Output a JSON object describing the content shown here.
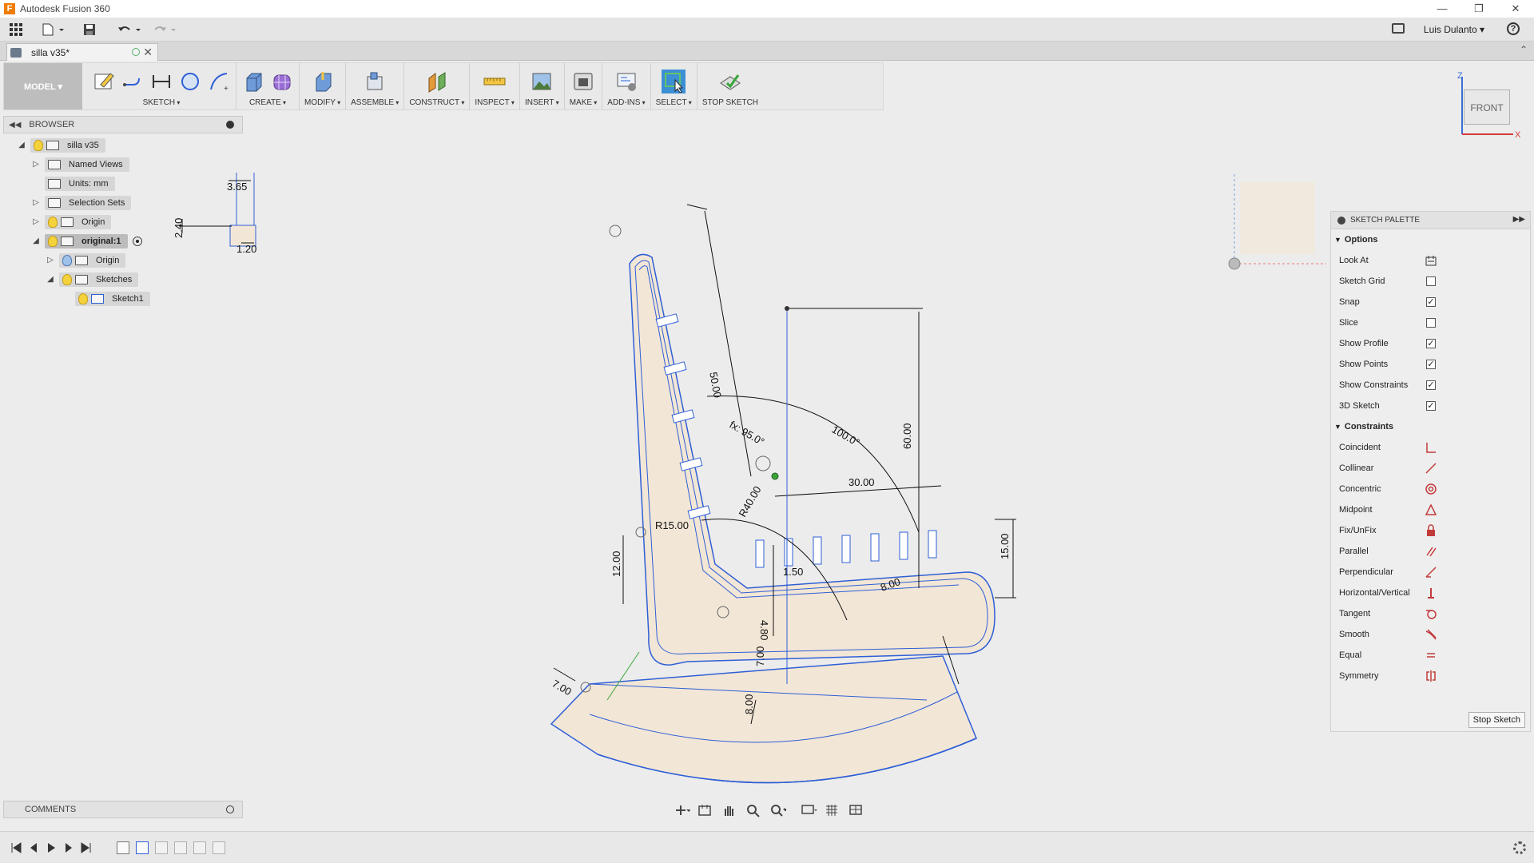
{
  "window": {
    "title": "Autodesk Fusion 360",
    "minimize": "—",
    "restore": "❐",
    "close": "✕"
  },
  "quick_access": {
    "user": "Luis Dulanto ▾",
    "help": "?"
  },
  "document_tab": {
    "label": "silla v35*",
    "close": "✕"
  },
  "toolbar": {
    "workspace": "MODEL ▾",
    "groups": [
      {
        "label": "SKETCH"
      },
      {
        "label": "CREATE"
      },
      {
        "label": "MODIFY"
      },
      {
        "label": "ASSEMBLE"
      },
      {
        "label": "CONSTRUCT"
      },
      {
        "label": "INSPECT"
      },
      {
        "label": "INSERT"
      },
      {
        "label": "MAKE"
      },
      {
        "label": "ADD-INS"
      },
      {
        "label": "SELECT"
      },
      {
        "label": "STOP SKETCH"
      }
    ]
  },
  "browser": {
    "title": "BROWSER",
    "items": [
      {
        "label": "silla v35"
      },
      {
        "label": "Named Views"
      },
      {
        "label": "Units: mm"
      },
      {
        "label": "Selection Sets"
      },
      {
        "label": "Origin"
      },
      {
        "label": "original:1"
      },
      {
        "label": "Origin"
      },
      {
        "label": "Sketches"
      },
      {
        "label": "Sketch1"
      }
    ]
  },
  "viewcube": {
    "face": "FRONT",
    "z": "Z",
    "x": "X"
  },
  "palette": {
    "title": "SKETCH PALETTE",
    "options_title": "Options",
    "options": [
      {
        "label": "Look At",
        "type": "icon",
        "icon": "look-at-icon"
      },
      {
        "label": "Sketch Grid",
        "checked": false
      },
      {
        "label": "Snap",
        "checked": true
      },
      {
        "label": "Slice",
        "checked": false
      },
      {
        "label": "Show Profile",
        "checked": true
      },
      {
        "label": "Show Points",
        "checked": true
      },
      {
        "label": "Show Constraints",
        "checked": true
      },
      {
        "label": "3D Sketch",
        "checked": true
      }
    ],
    "constraints_title": "Constraints",
    "constraints": [
      {
        "label": "Coincident",
        "icon": "coincident-icon"
      },
      {
        "label": "Collinear",
        "icon": "collinear-icon"
      },
      {
        "label": "Concentric",
        "icon": "concentric-icon"
      },
      {
        "label": "Midpoint",
        "icon": "midpoint-icon"
      },
      {
        "label": "Fix/UnFix",
        "icon": "fix-icon"
      },
      {
        "label": "Parallel",
        "icon": "parallel-icon"
      },
      {
        "label": "Perpendicular",
        "icon": "perpendicular-icon"
      },
      {
        "label": "Horizontal/Vertical",
        "icon": "horizontal-vertical-icon"
      },
      {
        "label": "Tangent",
        "icon": "tangent-icon"
      },
      {
        "label": "Smooth",
        "icon": "smooth-icon"
      },
      {
        "label": "Equal",
        "icon": "equal-icon"
      },
      {
        "label": "Symmetry",
        "icon": "symmetry-icon"
      }
    ],
    "stop_button": "Stop Sketch"
  },
  "sketch": {
    "dimensions": [
      "3.65",
      "2.40",
      "1.20",
      "50.00",
      "60.00",
      "30.00",
      "100.0°",
      "fx: 95.0°",
      "R40.00",
      "R15.00",
      "15.00",
      "12.00",
      "8.00",
      "7.00",
      "4.80",
      "1.50",
      "8.00",
      "7.00"
    ]
  },
  "comments": {
    "title": "COMMENTS"
  },
  "colors": {
    "sketch_line": "#2e5fd6",
    "profile_fill": "#f2e6d6",
    "dimension": "#111111",
    "accent": "#3d8fd4"
  }
}
